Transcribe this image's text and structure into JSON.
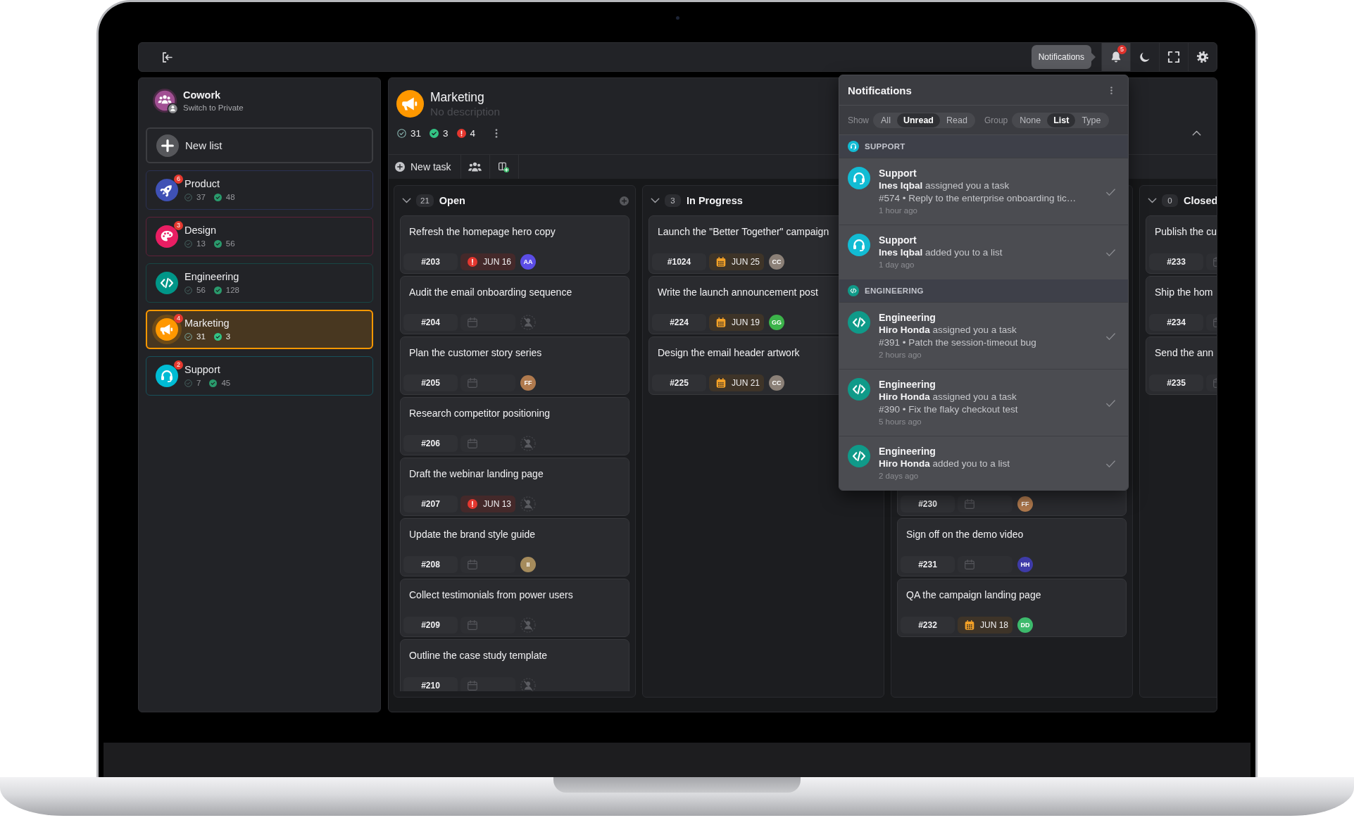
{
  "topbar": {
    "tooltip": "Notifications",
    "actions": [
      {
        "kind": "bell",
        "badge": "5",
        "active": true
      },
      {
        "kind": "moon",
        "active": false
      },
      {
        "kind": "fullscreen",
        "active": false
      },
      {
        "kind": "gear",
        "active": false
      }
    ]
  },
  "sidebar": {
    "workspace": {
      "name": "Cowork",
      "subtitle": "Switch to Private"
    },
    "new_list": "New list",
    "items": [
      {
        "name": "Product",
        "kind": "rocket",
        "color": "#3f51b5",
        "badge": "6",
        "open": "37",
        "done": "48",
        "selected": false
      },
      {
        "name": "Design",
        "kind": "palette",
        "color": "#e91e63",
        "badge": "3",
        "open": "13",
        "done": "56",
        "selected": false
      },
      {
        "name": "Engineering",
        "kind": "code",
        "color": "#009688",
        "open": "56",
        "done": "128",
        "selected": false
      },
      {
        "name": "Marketing",
        "kind": "megaphone",
        "color": "#ff9800",
        "badge": "4",
        "open": "31",
        "done": "3",
        "selected": true
      },
      {
        "name": "Support",
        "kind": "headset",
        "color": "#00bcd4",
        "badge": "2",
        "open": "7",
        "done": "45",
        "selected": false
      }
    ]
  },
  "list": {
    "title": "Marketing",
    "description": "No description",
    "open": "31",
    "done": "3",
    "overdue": "4"
  },
  "toolbar": {
    "new_task": "New task"
  },
  "columns": [
    {
      "name": "Open",
      "count": "21",
      "expanded": true,
      "addable": true,
      "cards": [
        {
          "title": "Refresh the homepage hero copy",
          "id": "#203",
          "due": {
            "kind": "overdue",
            "date": "JUN 16"
          },
          "assignee": {
            "kind": "person",
            "initials": "AA",
            "color": "#5b4de6"
          }
        },
        {
          "title": "Audit the email onboarding sequence",
          "id": "#204",
          "due": {
            "kind": "none"
          },
          "assignee": {
            "kind": "unassigned"
          }
        },
        {
          "title": "Plan the customer story series",
          "id": "#205",
          "due": {
            "kind": "none"
          },
          "assignee": {
            "kind": "person",
            "initials": "FF",
            "color": "#b07a4e"
          }
        },
        {
          "title": "Research competitor positioning",
          "id": "#206",
          "due": {
            "kind": "none"
          },
          "assignee": {
            "kind": "unassigned"
          }
        },
        {
          "title": "Draft the webinar landing page",
          "id": "#207",
          "due": {
            "kind": "overdue",
            "date": "JUN 13"
          },
          "assignee": {
            "kind": "unassigned"
          }
        },
        {
          "title": "Update the brand style guide",
          "id": "#208",
          "due": {
            "kind": "none"
          },
          "assignee": {
            "kind": "person",
            "initials": "II",
            "color": "#a58b5c"
          }
        },
        {
          "title": "Collect testimonials from power users",
          "id": "#209",
          "due": {
            "kind": "none"
          },
          "assignee": {
            "kind": "unassigned"
          }
        },
        {
          "title": "Outline the case study template",
          "id": "#210",
          "due": {
            "kind": "none"
          },
          "assignee": {
            "kind": "unassigned"
          }
        }
      ]
    },
    {
      "name": "In Progress",
      "count": "3",
      "expanded": true,
      "addable": false,
      "cards": [
        {
          "title": "Launch the \"Better Together\" campaign",
          "id": "#1024",
          "due": {
            "kind": "due",
            "date": "JUN 25"
          },
          "assignee": {
            "kind": "person",
            "initials": "CC",
            "color": "#8b8077"
          }
        },
        {
          "title": "Write the launch announcement post",
          "id": "#224",
          "due": {
            "kind": "due",
            "date": "JUN 19"
          },
          "assignee": {
            "kind": "person",
            "initials": "GG",
            "color": "#3cb34a"
          }
        },
        {
          "title": "Design the email header artwork",
          "id": "#225",
          "due": {
            "kind": "due",
            "date": "JUN 21"
          },
          "assignee": {
            "kind": "person",
            "initials": "CC",
            "color": "#8b8077"
          }
        }
      ]
    },
    {
      "cards": [
        {
          "id": "#230",
          "due": {
            "kind": "none"
          },
          "assignee": {
            "kind": "person",
            "initials": "FF",
            "color": "#b07a4e"
          }
        },
        {
          "title": "Sign off on the demo video",
          "id": "#231",
          "due": {
            "kind": "none"
          },
          "assignee": {
            "kind": "person",
            "initials": "HH",
            "color": "#3e3ba8"
          }
        },
        {
          "title": "QA the campaign landing page",
          "id": "#232",
          "due": {
            "kind": "due",
            "date": "JUN 18"
          },
          "assignee": {
            "kind": "person",
            "initials": "DD",
            "color": "#3dba6c"
          }
        }
      ]
    },
    {
      "name": "Closed",
      "count": "0",
      "expanded": true,
      "addable": false,
      "cards": [
        {
          "title": "Publish the cu",
          "id": "#233",
          "due": {
            "kind": "none"
          }
        },
        {
          "title": "Ship the hom",
          "id": "#234",
          "due": {
            "kind": "none"
          }
        },
        {
          "title": "Send the ann",
          "id": "#235",
          "due": {
            "kind": "none"
          }
        }
      ]
    }
  ],
  "notifications": {
    "title": "Notifications",
    "filters": [
      {
        "label": "Show",
        "options": [
          {
            "label": "All",
            "selected": false
          },
          {
            "label": "Unread",
            "selected": true
          },
          {
            "label": "Read",
            "selected": false
          }
        ]
      },
      {
        "label": "Group",
        "options": [
          {
            "label": "None",
            "selected": false
          },
          {
            "label": "List",
            "selected": true
          },
          {
            "label": "Type",
            "selected": false
          }
        ]
      }
    ],
    "groups": [
      {
        "name": "SUPPORT",
        "kind": "headset",
        "color": "#12bcd4",
        "items": [
          {
            "list": "Support",
            "message": "**Ines Iqbal** assigned you a task",
            "task": "#574 • Reply to the enterprise onboarding tic…",
            "time": "1 hour ago"
          },
          {
            "list": "Support",
            "message": "**Ines Iqbal** added you to a list",
            "time": "1 day ago"
          }
        ]
      },
      {
        "name": "ENGINEERING",
        "kind": "code",
        "color": "#0f9a89",
        "items": [
          {
            "list": "Engineering",
            "message": "**Hiro Honda** assigned you a task",
            "task": "#391 • Patch the session-timeout bug",
            "time": "2 hours ago"
          },
          {
            "list": "Engineering",
            "message": "**Hiro Honda** assigned you a task",
            "task": "#390 • Fix the flaky checkout test",
            "time": "5 hours ago"
          },
          {
            "list": "Engineering",
            "message": "**Hiro Honda** added you to a list",
            "time": "2 days ago"
          }
        ]
      }
    ]
  }
}
